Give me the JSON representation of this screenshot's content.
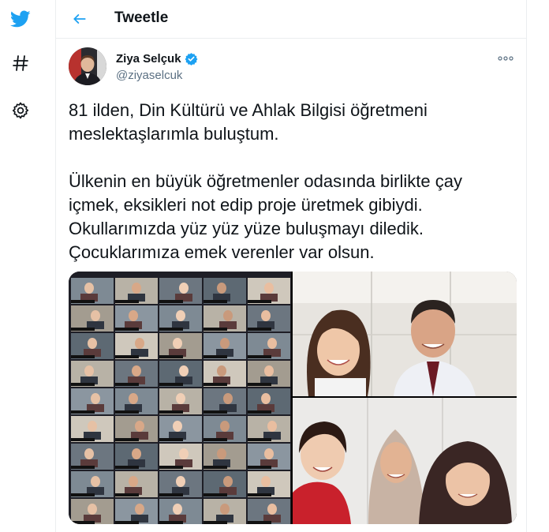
{
  "sidebar": {
    "logo_icon": "twitter-bird-icon",
    "explore_icon": "hashtag-icon",
    "settings_icon": "gear-icon"
  },
  "header": {
    "back_icon": "arrow-left-icon",
    "title": "Tweetle"
  },
  "tweet": {
    "author_name": "Ziya Selçuk",
    "author_handle": "@ziyaselcuk",
    "verified_icon": "verified-badge-icon",
    "more_icon": "more-horizontal-icon",
    "paragraphs": [
      "81 ilden, Din Kültürü ve Ahlak Bilgisi öğretmeni meslektaşlarımla buluştum.",
      "Ülkenin en büyük öğretmenler odasında birlikte çay içmek, eksikleri not edip proje üretmek gibiydi. Okullarımızda yüz yüz yüze buluşmayı diledik. Çocuklarımıza emek verenler var olsun."
    ],
    "media": [
      {
        "alt": "video-conference-grid"
      },
      {
        "alt": "girl-and-man-selfie"
      },
      {
        "alt": "mother-and-children-selfie"
      }
    ]
  },
  "colors": {
    "accent": "#1da1f2",
    "text": "#0f1419",
    "secondary": "#5b7083",
    "border": "#ebeef0"
  }
}
